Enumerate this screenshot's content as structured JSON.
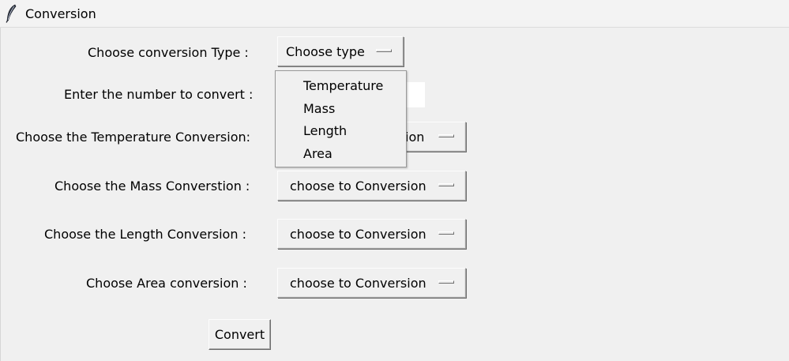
{
  "window": {
    "title": "Conversion",
    "icon": "feather-icon"
  },
  "form": {
    "type_label": "Choose conversion Type :",
    "number_label": "Enter the number to convert :",
    "temperature_label": "Choose the Temperature Conversion:",
    "mass_label": "Choose the Mass Converstion :",
    "length_label": "Choose the Length Conversion :",
    "area_label": "Choose Area conversion :",
    "type_menu_value": "Choose type",
    "temperature_menu_value": "choose to Conversion",
    "temperature_menu_visible_fragment": "ion",
    "mass_menu_value": "choose to Conversion",
    "length_menu_value": "choose to Conversion",
    "area_menu_value": "choose to Conversion",
    "number_input_value": "",
    "convert_label": "Convert"
  },
  "dropdown": {
    "items": [
      "Temperature",
      "Mass",
      "Length",
      "Area"
    ]
  }
}
